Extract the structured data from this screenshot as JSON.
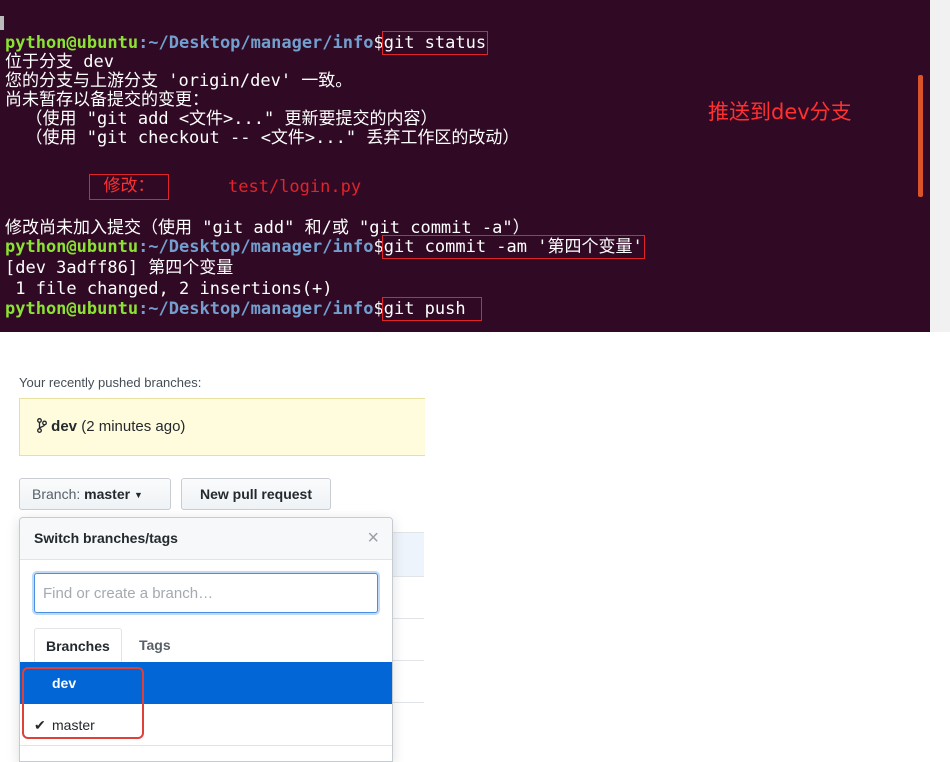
{
  "terminal": {
    "prompt_user": "python@ubuntu",
    "prompt_path": ":~/Desktop/manager/info",
    "prompt_symbol": "$",
    "cmd1": "git status",
    "lines": [
      "位于分支 dev",
      "您的分支与上游分支 'origin/dev' 一致。",
      "尚未暂存以备提交的变更：",
      "  （使用 \"git add <文件>...\" 更新要提交的内容）",
      "  （使用 \"git checkout -- <文件>...\" 丢弃工作区的改动）"
    ],
    "modified_label": "修改：",
    "modified_file": "test/login.py",
    "summary": "修改尚未加入提交（使用 \"git add\" 和/或 \"git commit -a\"）",
    "cmd2": "git commit -am '第四个变量'",
    "commit_line": "[dev 3adff86] 第四个变量",
    "changed_line": " 1 file changed, 2 insertions(+)",
    "cmd3": "git push",
    "annotation": "推送到dev分支"
  },
  "github": {
    "recent_label": "Your recently pushed branches:",
    "recent_branch": "dev",
    "recent_time": "(2 minutes ago)",
    "branch_button_label": "Branch:",
    "branch_button_value": "master",
    "new_pr_label": "New pull request",
    "dropdown": {
      "title": "Switch branches/tags",
      "close": "×",
      "input_placeholder": "Find or create a branch…",
      "tabs": [
        "Branches",
        "Tags"
      ],
      "items": [
        {
          "label": "dev",
          "selected": true,
          "checked": false
        },
        {
          "label": "master",
          "selected": false,
          "checked": true
        }
      ]
    }
  },
  "colors": {
    "terminal_bg": "#300a24",
    "prompt_user": "#8ae234",
    "prompt_path": "#729fcf",
    "annotation_red": "#e0242a",
    "selected_blue": "#0366d6",
    "banner_yellow": "#fffbdd"
  }
}
